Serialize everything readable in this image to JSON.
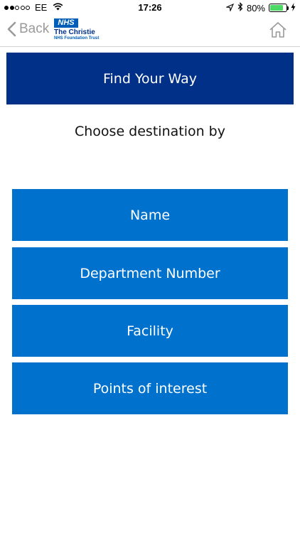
{
  "status_bar": {
    "carrier": "EE",
    "time": "17:26",
    "battery_percent": "80%",
    "signal_bars_filled": 2,
    "signal_bars_total": 5,
    "battery_level": 0.8,
    "battery_color": "#4cd964"
  },
  "nav": {
    "back_label": "Back",
    "logo": {
      "badge": "NHS",
      "name": "The Christie",
      "trust": "NHS Foundation Trust"
    },
    "home_icon": "home-icon"
  },
  "page": {
    "title": "Find Your Way",
    "subtitle": "Choose destination by"
  },
  "options": [
    {
      "label": "Name"
    },
    {
      "label": "Department Number"
    },
    {
      "label": "Facility"
    },
    {
      "label": "Points of interest"
    }
  ],
  "colors": {
    "banner": "#003087",
    "option_button": "#0072ce",
    "logo_blue": "#005eb8"
  }
}
